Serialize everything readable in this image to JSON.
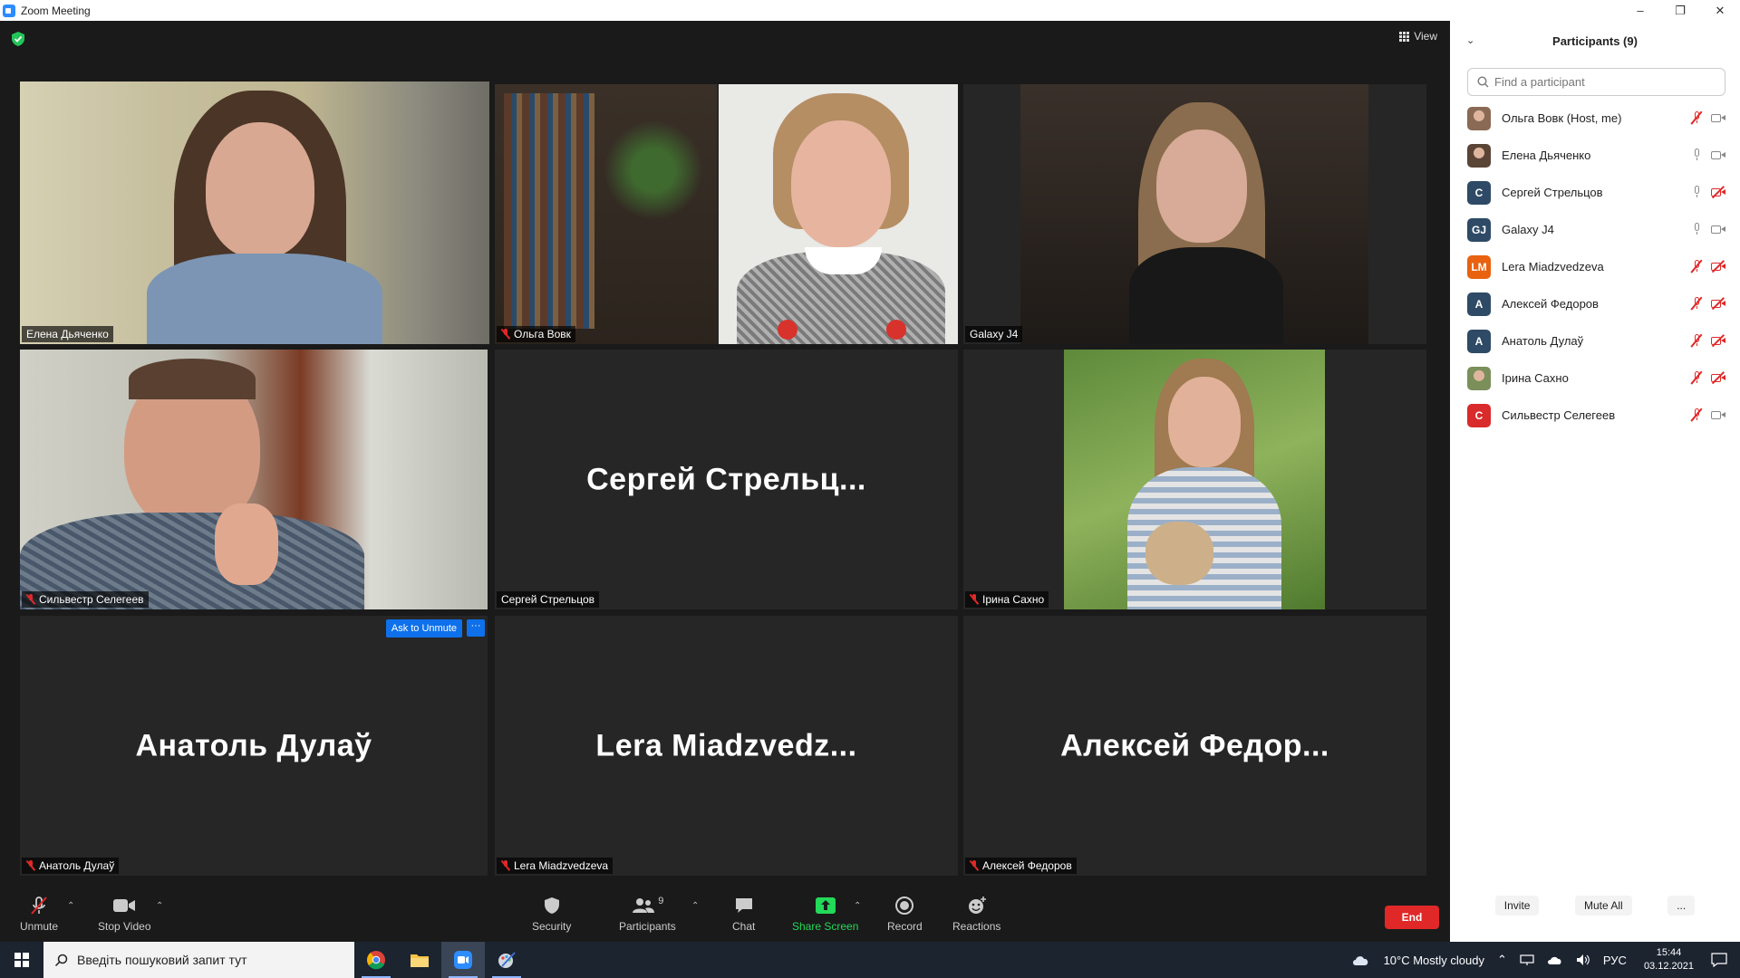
{
  "window": {
    "title": "Zoom Meeting",
    "controls": [
      "–",
      "❐",
      "✕"
    ]
  },
  "header": {
    "view_label": "View"
  },
  "tiles": [
    {
      "name": "Елена Дьяченко",
      "muted": false,
      "video": true,
      "active": true
    },
    {
      "name": "Ольга Вовк",
      "muted": true,
      "video": true
    },
    {
      "name": "Galaxy J4",
      "muted": false,
      "video": true
    },
    {
      "name": "Сильвестр Селегеев",
      "muted": true,
      "video": true
    },
    {
      "name": "Сергей Стрельцов",
      "big_name": "Сергей  Стрельц...",
      "muted": false,
      "video": false
    },
    {
      "name": "Ірина Сахно",
      "muted": true,
      "video": true
    },
    {
      "name": "Анатоль Дулаў",
      "big_name": "Анатоль Дулаў",
      "muted": true,
      "video": false
    },
    {
      "name": "Lera Miadzvedzeva",
      "big_name": "Lera  Miadzvedz...",
      "muted": true,
      "video": false
    },
    {
      "name": "Алексей Федоров",
      "big_name": "Алексей  Федор...",
      "muted": true,
      "video": false
    }
  ],
  "hover_actions": {
    "ask_to_unmute": "Ask to Unmute",
    "more": "···"
  },
  "toolbar": {
    "unmute": "Unmute",
    "stop_video": "Stop Video",
    "security": "Security",
    "participants": "Participants",
    "participants_count": "9",
    "chat": "Chat",
    "share_screen": "Share Screen",
    "record": "Record",
    "reactions": "Reactions",
    "end": "End"
  },
  "panel": {
    "title": "Participants (9)",
    "search_placeholder": "Find a participant",
    "participants": [
      {
        "name": "Ольга Вовк (Host, me)",
        "avatar": "photo",
        "color": "#8a6a55",
        "mic": "off",
        "cam": "on"
      },
      {
        "name": "Елена Дьяченко",
        "avatar": "photo",
        "color": "#5a4436",
        "mic": "on",
        "cam": "on"
      },
      {
        "name": "Сергей Стрельцов",
        "avatar": "C",
        "color": "#2e4a66",
        "mic": "on",
        "cam": "off"
      },
      {
        "name": "Galaxy J4",
        "avatar": "GJ",
        "color": "#2e4a66",
        "mic": "on",
        "cam": "on"
      },
      {
        "name": "Lera Miadzvedzeva",
        "avatar": "LM",
        "color": "#e8620f",
        "mic": "off",
        "cam": "off"
      },
      {
        "name": "Алексей Федоров",
        "avatar": "A",
        "color": "#2e4a66",
        "mic": "off",
        "cam": "off"
      },
      {
        "name": "Анатоль Дулаў",
        "avatar": "A",
        "color": "#2e4a66",
        "mic": "off",
        "cam": "off"
      },
      {
        "name": "Ірина Сахно",
        "avatar": "photo",
        "color": "#7a8f5a",
        "mic": "off",
        "cam": "off"
      },
      {
        "name": "Сильвестр Селегеев",
        "avatar": "C",
        "color": "#d92b2b",
        "mic": "off",
        "cam": "on"
      }
    ],
    "invite": "Invite",
    "mute_all": "Mute All",
    "more": "..."
  },
  "taskbar": {
    "search_placeholder": "Введіть пошуковий запит тут",
    "weather": "10°C  Mostly cloudy",
    "lang": "РУС",
    "time": "15:44",
    "date": "03.12.2021"
  },
  "colors": {
    "active_speaker": "#d9e35a",
    "end_red": "#e02828",
    "share_green": "#23d959",
    "accent_blue": "#0e71eb"
  }
}
